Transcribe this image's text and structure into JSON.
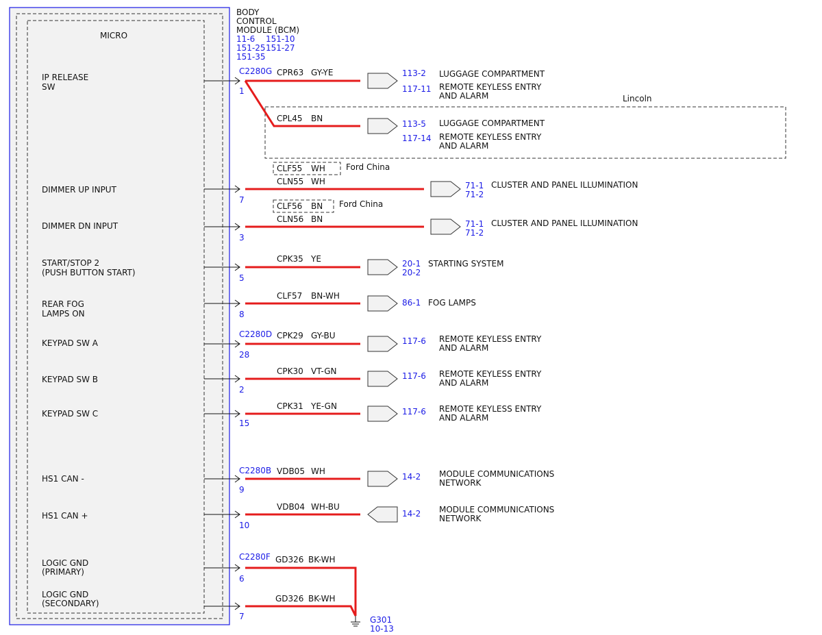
{
  "module": {
    "name_lines": [
      "BODY",
      "CONTROL",
      "MODULE (BCM)"
    ],
    "refs": [
      "11-6",
      "151-10",
      "151-25",
      "151-27",
      "151-35"
    ],
    "micro_label": "MICRO"
  },
  "signals": [
    {
      "id": "ip-release-sw",
      "lines": [
        "IP RELEASE",
        "SW"
      ]
    },
    {
      "id": "dimmer-up-input",
      "lines": [
        "DIMMER UP INPUT"
      ]
    },
    {
      "id": "dimmer-dn-input",
      "lines": [
        "DIMMER DN INPUT"
      ]
    },
    {
      "id": "start-stop-2",
      "lines": [
        "START/STOP 2",
        "(PUSH BUTTON START)"
      ]
    },
    {
      "id": "rear-fog-lamps-on",
      "lines": [
        "REAR FOG",
        "LAMPS ON"
      ]
    },
    {
      "id": "keypad-sw-a",
      "lines": [
        "KEYPAD SW A"
      ]
    },
    {
      "id": "keypad-sw-b",
      "lines": [
        "KEYPAD SW B"
      ]
    },
    {
      "id": "keypad-sw-c",
      "lines": [
        "KEYPAD SW C"
      ]
    },
    {
      "id": "hs1-can-minus",
      "lines": [
        "HS1 CAN -"
      ]
    },
    {
      "id": "hs1-can-plus",
      "lines": [
        "HS1 CAN +"
      ]
    },
    {
      "id": "logic-gnd-primary",
      "lines": [
        "LOGIC GND",
        "(PRIMARY)"
      ]
    },
    {
      "id": "logic-gnd-secondary",
      "lines": [
        "LOGIC GND",
        "(SECONDARY)"
      ]
    }
  ],
  "connectors": [
    "C2280G",
    "C2280D",
    "C2280B",
    "C2280F"
  ],
  "pins": [
    "1",
    "7",
    "3",
    "5",
    "8",
    "28",
    "2",
    "15",
    "9",
    "10",
    "6",
    "7"
  ],
  "circuits": [
    {
      "id": "cpr63",
      "code": "CPR63",
      "color": "GY-YE",
      "refs": [
        "113-2",
        "117-11"
      ],
      "dests": [
        "LUGGAGE COMPARTMENT",
        "REMOTE KEYLESS ENTRY",
        "AND ALARM"
      ]
    },
    {
      "id": "cpl45",
      "code": "CPL45",
      "color": "BN",
      "refs": [
        "113-5",
        "117-14"
      ],
      "dests": [
        "LUGGAGE COMPARTMENT",
        "REMOTE KEYLESS ENTRY",
        "AND ALARM"
      ]
    },
    {
      "id": "cln55",
      "code": "CLN55",
      "color": "WH",
      "refs": [
        "71-1",
        "71-2"
      ],
      "dests": [
        "CLUSTER AND PANEL ILLUMINATION"
      ]
    },
    {
      "id": "cln56",
      "code": "CLN56",
      "color": "BN",
      "refs": [
        "71-1",
        "71-2"
      ],
      "dests": [
        "CLUSTER AND PANEL ILLUMINATION"
      ]
    },
    {
      "id": "cpk35",
      "code": "CPK35",
      "color": "YE",
      "refs": [
        "20-1",
        "20-2"
      ],
      "dests": [
        "STARTING SYSTEM"
      ]
    },
    {
      "id": "clf57",
      "code": "CLF57",
      "color": "BN-WH",
      "refs": [
        "86-1"
      ],
      "dests": [
        "FOG LAMPS"
      ]
    },
    {
      "id": "cpk29",
      "code": "CPK29",
      "color": "GY-BU",
      "refs": [
        "117-6"
      ],
      "dests": [
        "REMOTE KEYLESS ENTRY",
        "AND ALARM"
      ]
    },
    {
      "id": "cpk30",
      "code": "CPK30",
      "color": "VT-GN",
      "refs": [
        "117-6"
      ],
      "dests": [
        "REMOTE KEYLESS ENTRY",
        "AND ALARM"
      ]
    },
    {
      "id": "cpk31",
      "code": "CPK31",
      "color": "YE-GN",
      "refs": [
        "117-6"
      ],
      "dests": [
        "REMOTE KEYLESS ENTRY",
        "AND ALARM"
      ]
    },
    {
      "id": "vdb05",
      "code": "VDB05",
      "color": "WH",
      "refs": [
        "14-2"
      ],
      "dests": [
        "MODULE COMMUNICATIONS",
        "NETWORK"
      ]
    },
    {
      "id": "vdb04",
      "code": "VDB04",
      "color": "WH-BU",
      "refs": [
        "14-2"
      ],
      "dests": [
        "MODULE COMMUNICATIONS",
        "NETWORK"
      ]
    },
    {
      "id": "gd326-primary",
      "code": "GD326",
      "color": "BK-WH"
    },
    {
      "id": "gd326-secondary",
      "code": "GD326",
      "color": "BK-WH"
    }
  ],
  "alternates": [
    {
      "code": "CLF55",
      "color": "WH",
      "market": "Ford China"
    },
    {
      "code": "CLF56",
      "color": "BN",
      "market": "Ford China"
    }
  ],
  "variant_label": "Lincoln",
  "ground": {
    "name": "G301",
    "ref": "10-13"
  },
  "colors": {
    "wire": "#e51c1c",
    "refs": "#1a1ae6",
    "module_border": "#1a1ae6",
    "module_fill": "#f2f2f2"
  }
}
